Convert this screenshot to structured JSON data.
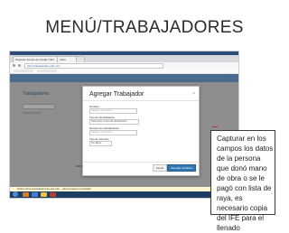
{
  "slide": {
    "title": "MENÚ/TRABAJADORES"
  },
  "browser": {
    "tabs": [
      "Pequeño Fondo de Crédito Tábr...",
      "Inicio"
    ],
    "url": "pfct.mhtoacapulco.gob.mx/..."
  },
  "page": {
    "heading": "Trabajadores",
    "footer": "ARRIL 2014"
  },
  "modal": {
    "title": "Agregar Trabajador",
    "close_glyph": "×",
    "fields": [
      {
        "label": "Nombre",
        "placeholder": "Capture un nombre"
      },
      {
        "label": "Tipo de identificación",
        "value": "Seleccione el tipo de identificación"
      },
      {
        "label": "Número de identificación",
        "placeholder": "Capture un número"
      },
      {
        "label": "Tipo de Servicio",
        "value": "Por Raya"
      }
    ],
    "close_button": "Cerrar",
    "save_button": "Guardar Cambios"
  },
  "notice": {
    "text": "Firefox cierra automáticamente este sitio ... para proteger tu privacidad."
  },
  "callout": {
    "text": "Capturar en los campos los datos de la persona que donó mano de obra o se le pagó con lista de raya, es necesario copia del IFE para el llenado"
  },
  "colors": {
    "accent": "#3276b1",
    "header": "#4a6b8e",
    "taskbar": "#1f3d63",
    "overlay": "#8e8e8e"
  }
}
